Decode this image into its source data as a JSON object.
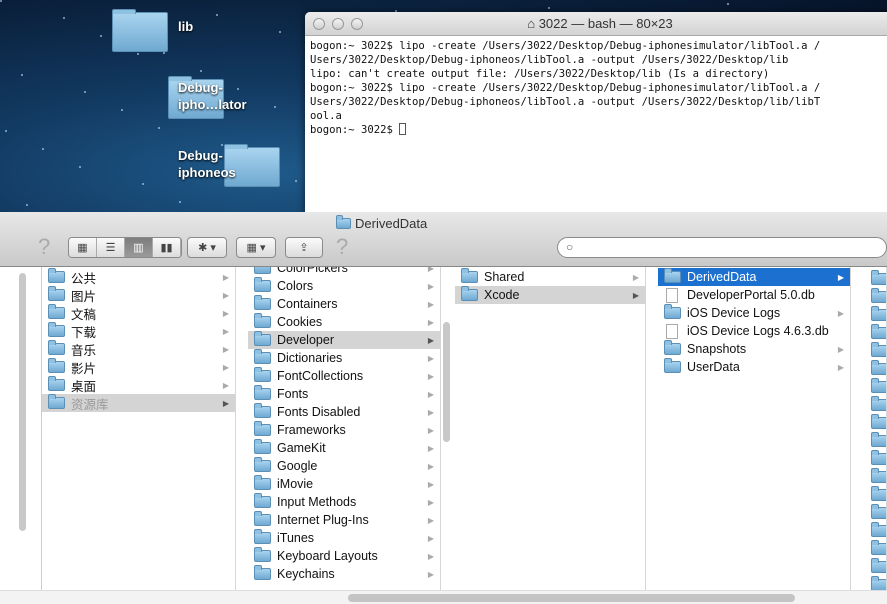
{
  "desktop": {
    "icons": [
      {
        "label": "lib"
      },
      {
        "label": "Debug-\nipho…lator"
      },
      {
        "label": "Debug-\niphoneos"
      }
    ]
  },
  "terminal": {
    "title": "3022 — bash — 80×23",
    "lines": [
      "bogon:~ 3022$ lipo -create /Users/3022/Desktop/Debug-iphonesimulator/libTool.a /",
      "Users/3022/Desktop/Debug-iphoneos/libTool.a -output /Users/3022/Desktop/lib",
      "lipo: can't create output file: /Users/3022/Desktop/lib (Is a directory)",
      "bogon:~ 3022$ lipo -create /Users/3022/Desktop/Debug-iphonesimulator/libTool.a /",
      "Users/3022/Desktop/Debug-iphoneos/libTool.a -output /Users/3022/Desktop/lib/libT",
      "ool.a"
    ],
    "prompt": "bogon:~ 3022$ "
  },
  "finder": {
    "title": "DerivedData",
    "search_placeholder": "",
    "view_modes": [
      "icon",
      "list",
      "column",
      "coverflow"
    ],
    "active_view": "column",
    "columns": [
      {
        "items": [
          {
            "label": "公共"
          },
          {
            "label": "图片"
          },
          {
            "label": "文稿"
          },
          {
            "label": "下载"
          },
          {
            "label": "音乐"
          },
          {
            "label": "影片"
          },
          {
            "label": "桌面"
          },
          {
            "label": "资源库",
            "selected": true
          }
        ]
      },
      {
        "items": [
          {
            "label": "ColorPickers"
          },
          {
            "label": "Colors"
          },
          {
            "label": "Containers"
          },
          {
            "label": "Cookies"
          },
          {
            "label": "Developer",
            "selected": true
          },
          {
            "label": "Dictionaries"
          },
          {
            "label": "FontCollections"
          },
          {
            "label": "Fonts"
          },
          {
            "label": "Fonts Disabled"
          },
          {
            "label": "Frameworks"
          },
          {
            "label": "GameKit"
          },
          {
            "label": "Google"
          },
          {
            "label": "iMovie"
          },
          {
            "label": "Input Methods"
          },
          {
            "label": "Internet Plug-Ins"
          },
          {
            "label": "iTunes"
          },
          {
            "label": "Keyboard Layouts"
          },
          {
            "label": "Keychains"
          }
        ]
      },
      {
        "items": [
          {
            "label": "Shared"
          },
          {
            "label": "Xcode",
            "selected": true
          }
        ]
      },
      {
        "items": [
          {
            "label": "DerivedData",
            "active": true
          },
          {
            "label": "DeveloperPortal 5.0.db",
            "file": true
          },
          {
            "label": "iOS Device Logs"
          },
          {
            "label": "iOS Device Logs 4.6.3.db",
            "file": true
          },
          {
            "label": "Snapshots"
          },
          {
            "label": "UserData"
          }
        ]
      }
    ]
  },
  "colors": {
    "selection": "#1c70d0",
    "folder": "#8fc1e3"
  }
}
